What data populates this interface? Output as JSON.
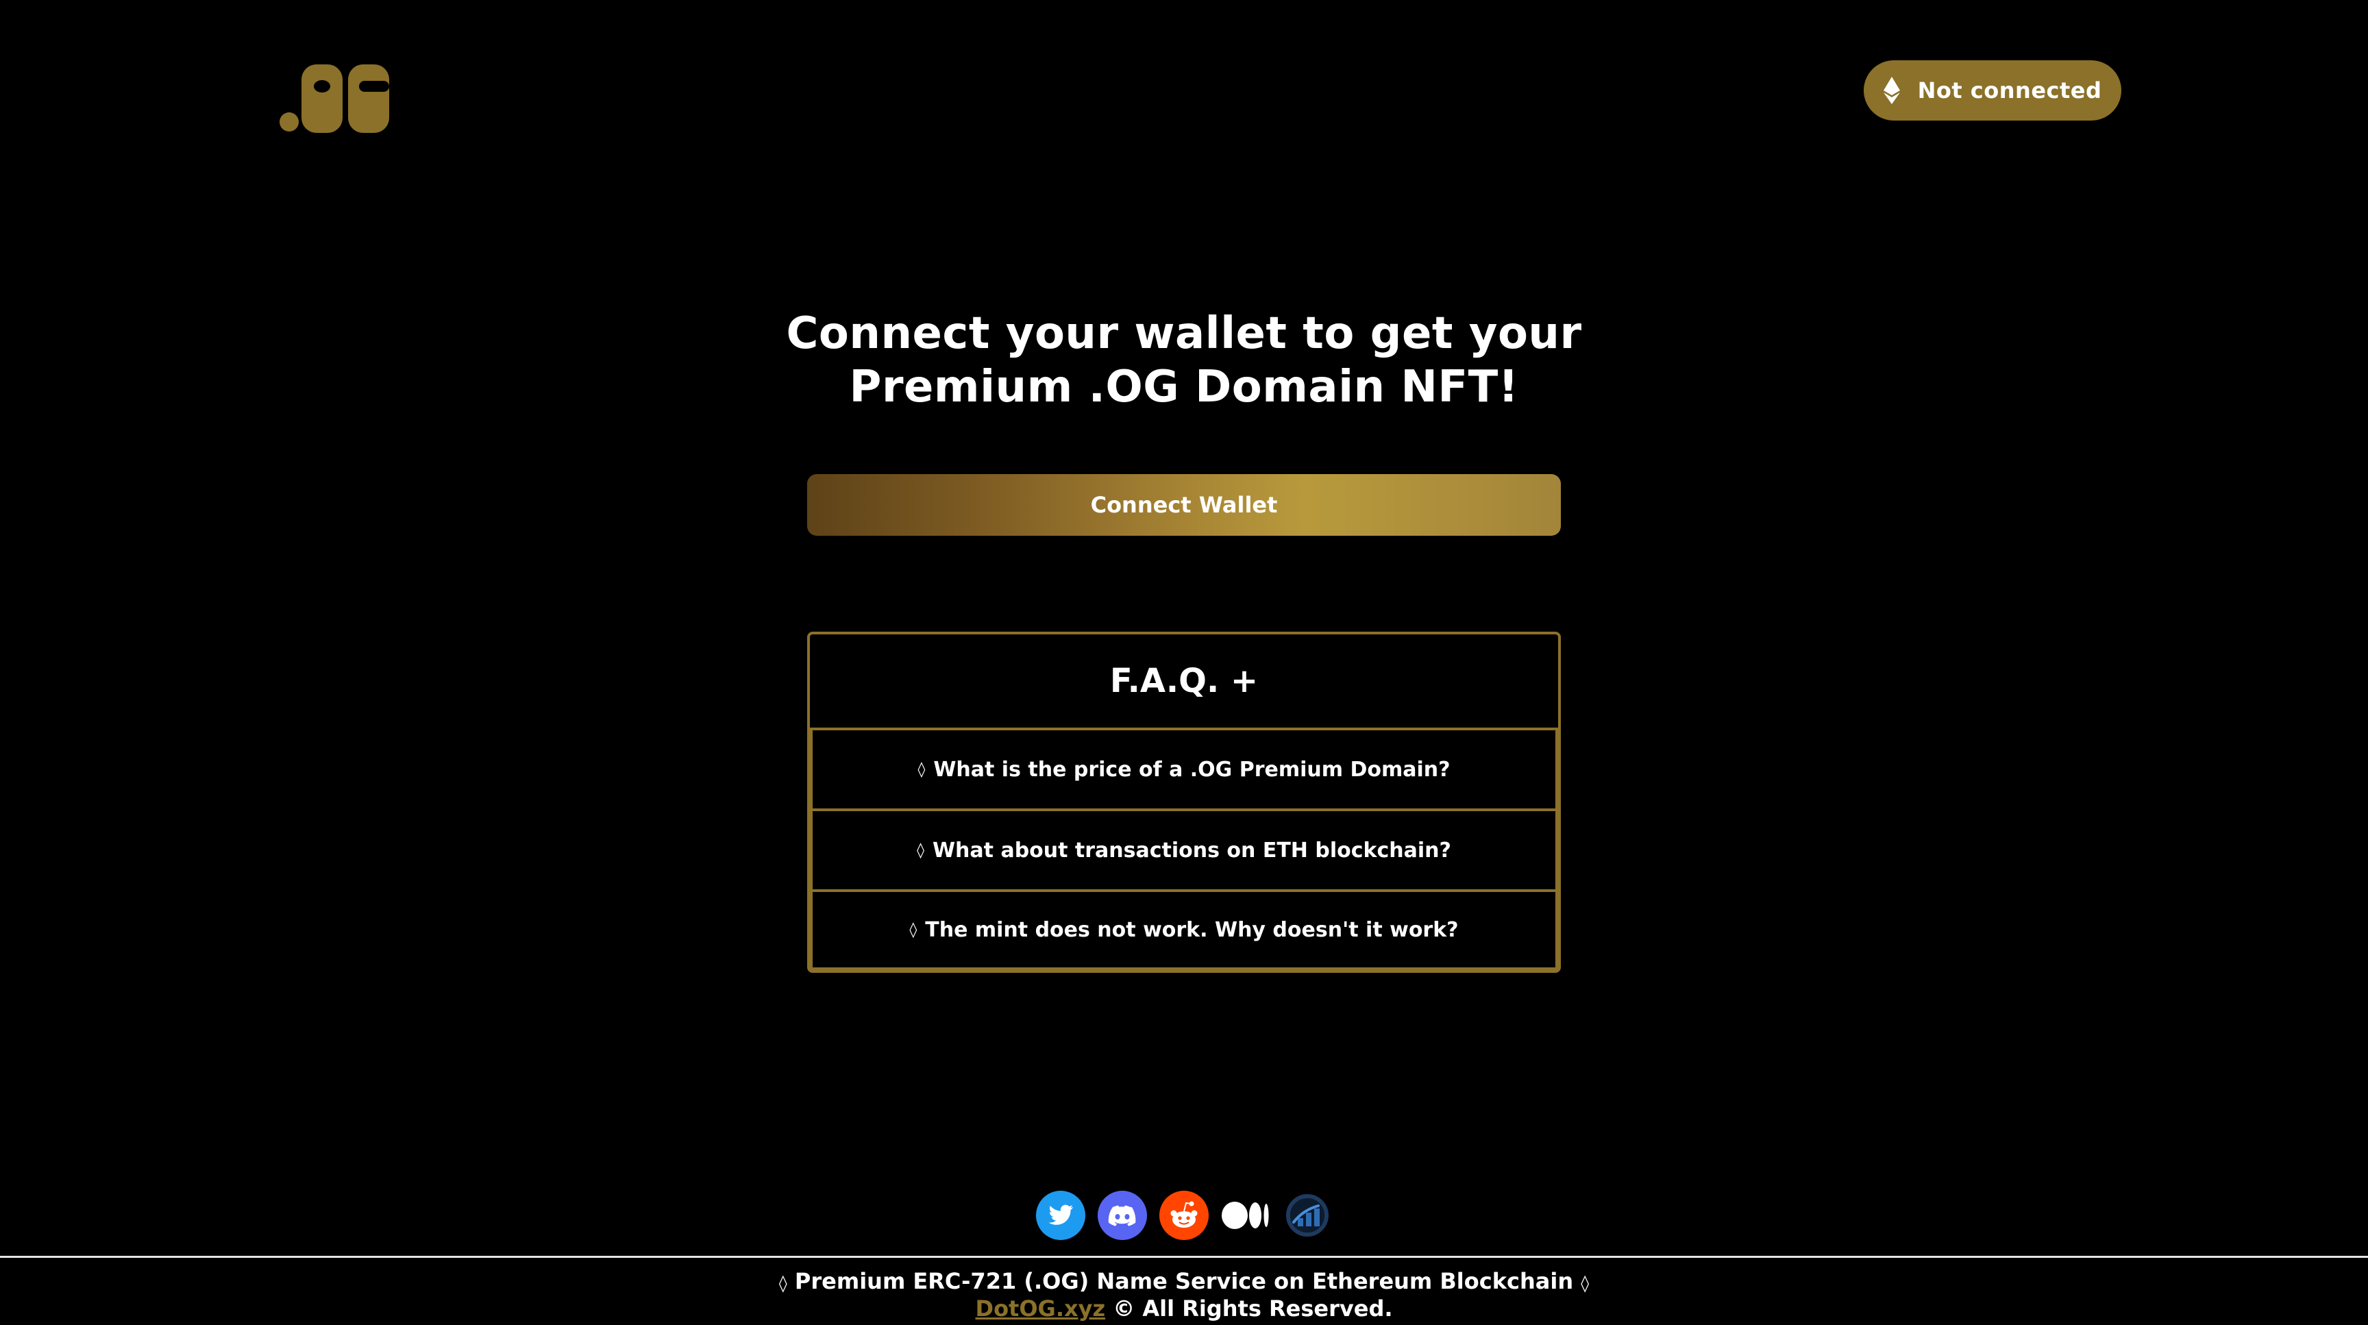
{
  "header": {
    "logo_text": ".OG",
    "connection_status": "Not connected",
    "eth_icon": "ethereum-icon"
  },
  "hero": {
    "headline_line1": "Connect your wallet to get your",
    "headline_line2": "Premium .OG Domain NFT!",
    "connect_button": "Connect Wallet"
  },
  "faq": {
    "title": "F.A.Q. +",
    "bullet": "◊",
    "items": [
      "What is the price of a .OG Premium Domain?",
      "What about transactions on ETH blockchain?",
      "The mint does not work. Why doesn't it work?"
    ]
  },
  "socials": [
    "twitter-icon",
    "discord-icon",
    "reddit-icon",
    "medium-icon",
    "coinmarketcap-icon"
  ],
  "footer": {
    "diamond": "◊",
    "line1": "Premium ERC-721 (.OG) Name Service on Ethereum Blockchain",
    "link": "DotOG.xyz",
    "rights": "© All Rights Reserved."
  },
  "colors": {
    "background": "#000000",
    "gold": "#8b7129",
    "twitter": "#1d9bf0",
    "discord": "#5865f2",
    "reddit": "#ff4500"
  }
}
